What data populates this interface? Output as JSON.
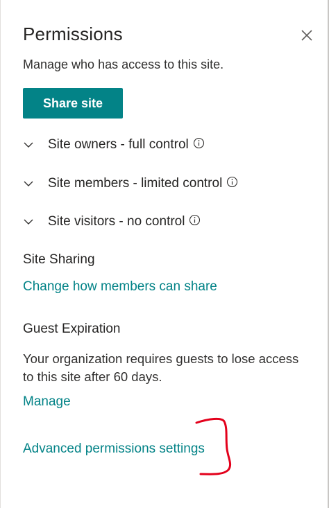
{
  "panel": {
    "title": "Permissions",
    "subtitle": "Manage who has access to this site.",
    "close_icon": "close-icon"
  },
  "share_button": {
    "label": "Share site",
    "color": "#038387"
  },
  "groups": [
    {
      "label": "Site owners - full control",
      "icon": "chevron-down-icon",
      "info_icon": "info-icon"
    },
    {
      "label": "Site members - limited control",
      "icon": "chevron-down-icon",
      "info_icon": "info-icon"
    },
    {
      "label": "Site visitors - no control",
      "icon": "chevron-down-icon",
      "info_icon": "info-icon"
    }
  ],
  "site_sharing": {
    "heading": "Site Sharing",
    "link": "Change how members can share"
  },
  "guest_expiration": {
    "heading": "Guest Expiration",
    "text": "Your organization requires guests to lose access to this site after 60 days.",
    "link": "Manage"
  },
  "advanced_link": "Advanced permissions settings",
  "colors": {
    "accent": "#038387",
    "annotation": "#e3001b"
  }
}
